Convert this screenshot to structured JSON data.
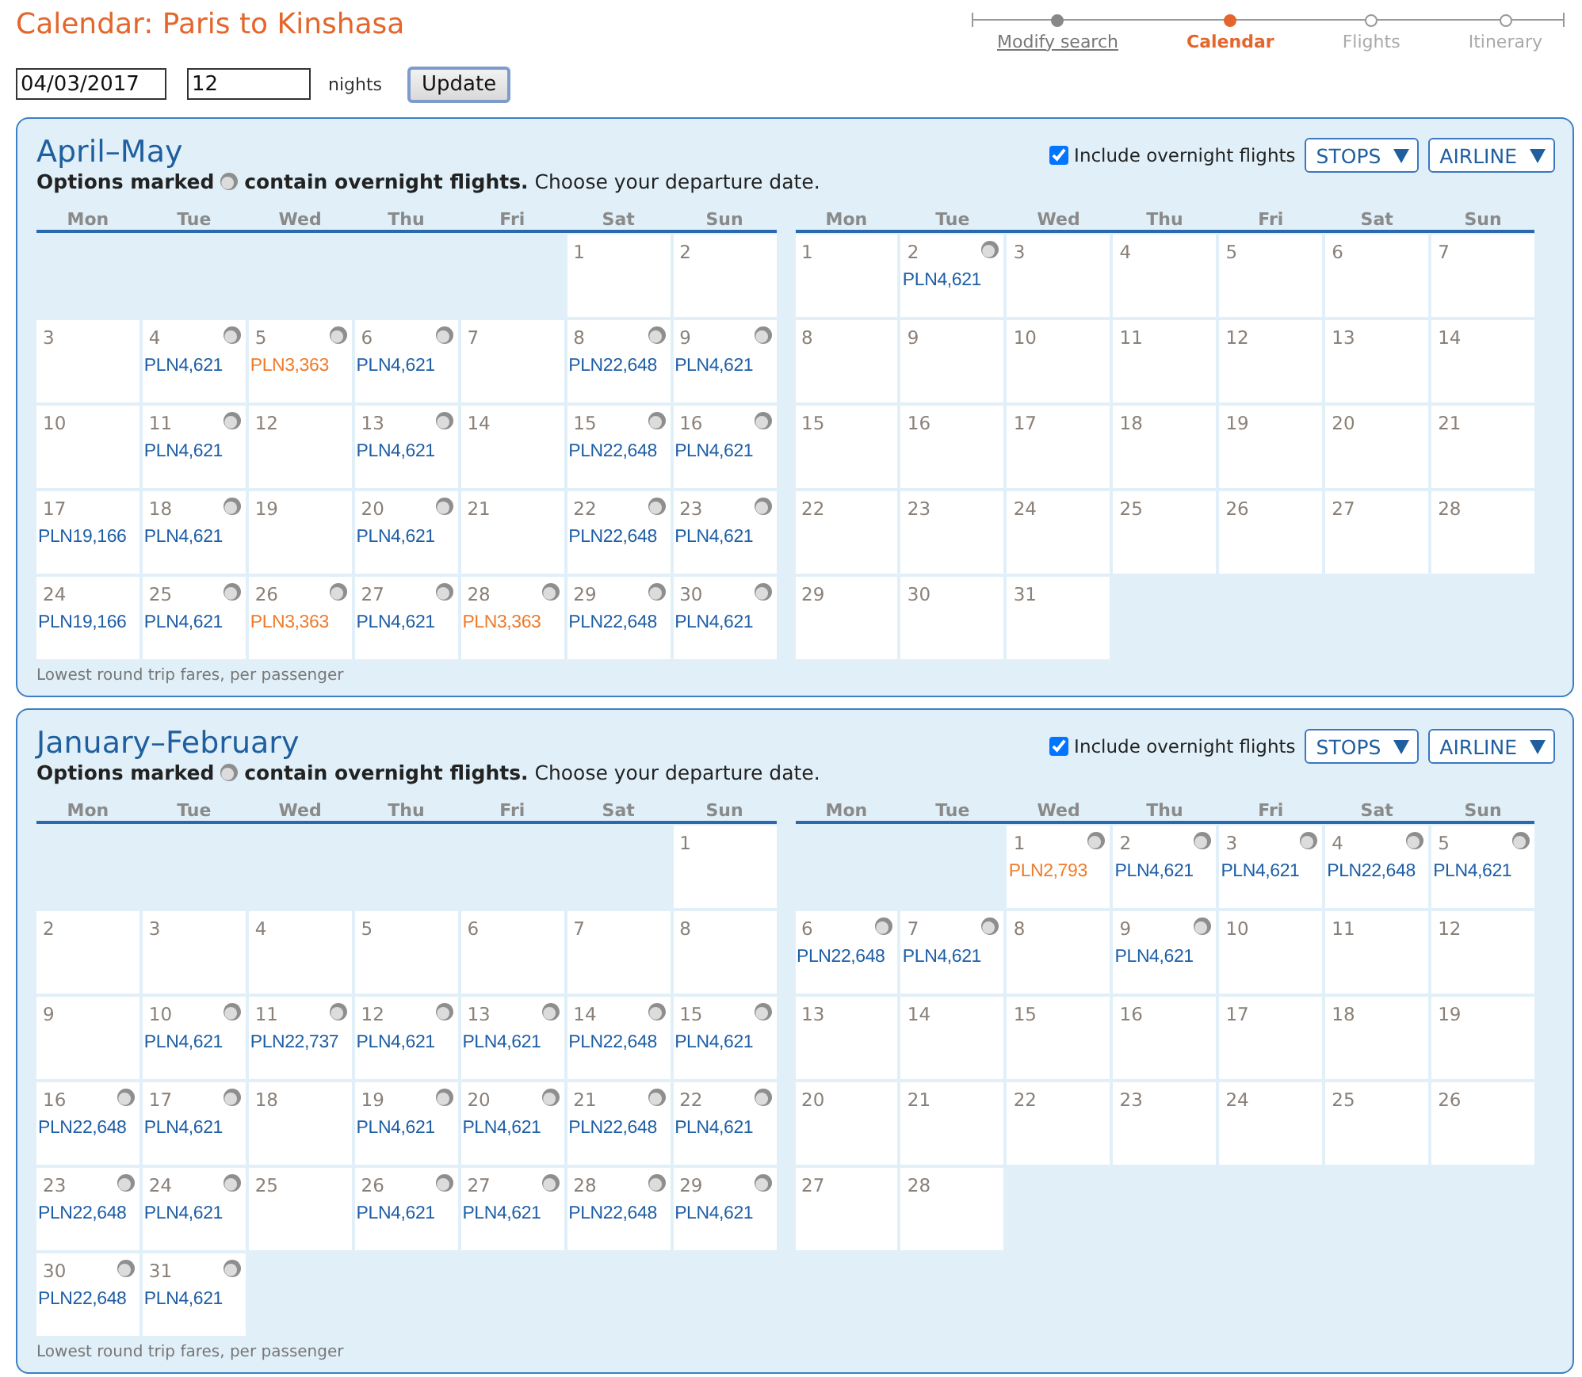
{
  "title": "Calendar: Paris to Kinshasa",
  "steps": [
    {
      "label": "Modify search",
      "completed": true,
      "selected": false
    },
    {
      "label": "Calendar",
      "completed": false,
      "selected": true
    },
    {
      "label": "Flights",
      "completed": false,
      "selected": false
    },
    {
      "label": "Itinerary",
      "completed": false,
      "selected": false
    }
  ],
  "search": {
    "date": "04/03/2017",
    "nights": "12",
    "nights_label": "nights",
    "button": "Update"
  },
  "panels": [
    {
      "title": "April–May",
      "legend": {
        "before": "Options marked",
        "after": "**contain overnight flights.** Choose your departure date."
      },
      "overnight_filter": {
        "label": "Include overnight flights",
        "checked": true
      },
      "filters": [
        {
          "label": "STOPS"
        },
        {
          "label": "AIRLINE"
        }
      ],
      "months": [
        {
          "weekdays": [
            "Mon",
            "Tue",
            "Wed",
            "Thu",
            "Fri",
            "Sat",
            "Sun"
          ],
          "days": [
            {
              "kind": "empty"
            },
            {
              "kind": "empty"
            },
            {
              "kind": "empty"
            },
            {
              "kind": "empty"
            },
            {
              "kind": "empty"
            },
            {
              "kind": "day",
              "day": "1",
              "overnight": false
            },
            {
              "kind": "day",
              "day": "2",
              "overnight": false
            },
            {
              "kind": "day",
              "day": "3",
              "overnight": false
            },
            {
              "kind": "day",
              "day": "4",
              "overnight": true,
              "fare": {
                "price": "PLN4,621",
                "lowest": false
              }
            },
            {
              "kind": "day",
              "day": "5",
              "overnight": true,
              "fare": {
                "price": "PLN3,363",
                "lowest": true
              }
            },
            {
              "kind": "day",
              "day": "6",
              "overnight": true,
              "fare": {
                "price": "PLN4,621",
                "lowest": false
              }
            },
            {
              "kind": "day",
              "day": "7",
              "overnight": false
            },
            {
              "kind": "day",
              "day": "8",
              "overnight": true,
              "fare": {
                "price": "PLN22,648",
                "lowest": false
              }
            },
            {
              "kind": "day",
              "day": "9",
              "overnight": true,
              "fare": {
                "price": "PLN4,621",
                "lowest": false
              }
            },
            {
              "kind": "day",
              "day": "10",
              "overnight": false
            },
            {
              "kind": "day",
              "day": "11",
              "overnight": true,
              "fare": {
                "price": "PLN4,621",
                "lowest": false
              }
            },
            {
              "kind": "day",
              "day": "12",
              "overnight": false
            },
            {
              "kind": "day",
              "day": "13",
              "overnight": true,
              "fare": {
                "price": "PLN4,621",
                "lowest": false
              }
            },
            {
              "kind": "day",
              "day": "14",
              "overnight": false
            },
            {
              "kind": "day",
              "day": "15",
              "overnight": true,
              "fare": {
                "price": "PLN22,648",
                "lowest": false
              }
            },
            {
              "kind": "day",
              "day": "16",
              "overnight": true,
              "fare": {
                "price": "PLN4,621",
                "lowest": false
              }
            },
            {
              "kind": "day",
              "day": "17",
              "overnight": false,
              "fare": {
                "price": "PLN19,166",
                "lowest": false
              }
            },
            {
              "kind": "day",
              "day": "18",
              "overnight": true,
              "fare": {
                "price": "PLN4,621",
                "lowest": false
              }
            },
            {
              "kind": "day",
              "day": "19",
              "overnight": false
            },
            {
              "kind": "day",
              "day": "20",
              "overnight": true,
              "fare": {
                "price": "PLN4,621",
                "lowest": false
              }
            },
            {
              "kind": "day",
              "day": "21",
              "overnight": false
            },
            {
              "kind": "day",
              "day": "22",
              "overnight": true,
              "fare": {
                "price": "PLN22,648",
                "lowest": false
              }
            },
            {
              "kind": "day",
              "day": "23",
              "overnight": true,
              "fare": {
                "price": "PLN4,621",
                "lowest": false
              }
            },
            {
              "kind": "day",
              "day": "24",
              "overnight": false,
              "fare": {
                "price": "PLN19,166",
                "lowest": false
              }
            },
            {
              "kind": "day",
              "day": "25",
              "overnight": true,
              "fare": {
                "price": "PLN4,621",
                "lowest": false
              }
            },
            {
              "kind": "day",
              "day": "26",
              "overnight": true,
              "fare": {
                "price": "PLN3,363",
                "lowest": true
              }
            },
            {
              "kind": "day",
              "day": "27",
              "overnight": true,
              "fare": {
                "price": "PLN4,621",
                "lowest": false
              }
            },
            {
              "kind": "day",
              "day": "28",
              "overnight": true,
              "fare": {
                "price": "PLN3,363",
                "lowest": true
              }
            },
            {
              "kind": "day",
              "day": "29",
              "overnight": true,
              "fare": {
                "price": "PLN22,648",
                "lowest": false
              }
            },
            {
              "kind": "day",
              "day": "30",
              "overnight": true,
              "fare": {
                "price": "PLN4,621",
                "lowest": false
              }
            }
          ]
        },
        {
          "weekdays": [
            "Mon",
            "Tue",
            "Wed",
            "Thu",
            "Fri",
            "Sat",
            "Sun"
          ],
          "days": [
            {
              "kind": "day",
              "day": "1",
              "overnight": false
            },
            {
              "kind": "day",
              "day": "2",
              "overnight": true,
              "fare": {
                "price": "PLN4,621",
                "lowest": false
              }
            },
            {
              "kind": "day",
              "day": "3",
              "overnight": false
            },
            {
              "kind": "day",
              "day": "4",
              "overnight": false
            },
            {
              "kind": "day",
              "day": "5",
              "overnight": false
            },
            {
              "kind": "day",
              "day": "6",
              "overnight": false
            },
            {
              "kind": "day",
              "day": "7",
              "overnight": false
            },
            {
              "kind": "day",
              "day": "8",
              "overnight": false
            },
            {
              "kind": "day",
              "day": "9",
              "overnight": false
            },
            {
              "kind": "day",
              "day": "10",
              "overnight": false
            },
            {
              "kind": "day",
              "day": "11",
              "overnight": false
            },
            {
              "kind": "day",
              "day": "12",
              "overnight": false
            },
            {
              "kind": "day",
              "day": "13",
              "overnight": false
            },
            {
              "kind": "day",
              "day": "14",
              "overnight": false
            },
            {
              "kind": "day",
              "day": "15",
              "overnight": false
            },
            {
              "kind": "day",
              "day": "16",
              "overnight": false
            },
            {
              "kind": "day",
              "day": "17",
              "overnight": false
            },
            {
              "kind": "day",
              "day": "18",
              "overnight": false
            },
            {
              "kind": "day",
              "day": "19",
              "overnight": false
            },
            {
              "kind": "day",
              "day": "20",
              "overnight": false
            },
            {
              "kind": "day",
              "day": "21",
              "overnight": false
            },
            {
              "kind": "day",
              "day": "22",
              "overnight": false
            },
            {
              "kind": "day",
              "day": "23",
              "overnight": false
            },
            {
              "kind": "day",
              "day": "24",
              "overnight": false
            },
            {
              "kind": "day",
              "day": "25",
              "overnight": false
            },
            {
              "kind": "day",
              "day": "26",
              "overnight": false
            },
            {
              "kind": "day",
              "day": "27",
              "overnight": false
            },
            {
              "kind": "day",
              "day": "28",
              "overnight": false
            },
            {
              "kind": "day",
              "day": "29",
              "overnight": false
            },
            {
              "kind": "day",
              "day": "30",
              "overnight": false
            },
            {
              "kind": "day",
              "day": "31",
              "overnight": false
            }
          ]
        }
      ],
      "footnote": "Lowest round trip fares, per passenger"
    },
    {
      "title": "January–February",
      "legend": {
        "before": "Options marked",
        "after": "**contain overnight flights.** Choose your departure date."
      },
      "overnight_filter": {
        "label": "Include overnight flights",
        "checked": true
      },
      "filters": [
        {
          "label": "STOPS"
        },
        {
          "label": "AIRLINE"
        }
      ],
      "months": [
        {
          "weekdays": [
            "Mon",
            "Tue",
            "Wed",
            "Thu",
            "Fri",
            "Sat",
            "Sun"
          ],
          "days": [
            {
              "kind": "empty"
            },
            {
              "kind": "empty"
            },
            {
              "kind": "empty"
            },
            {
              "kind": "empty"
            },
            {
              "kind": "empty"
            },
            {
              "kind": "empty"
            },
            {
              "kind": "day",
              "day": "1",
              "overnight": false
            },
            {
              "kind": "day",
              "day": "2",
              "overnight": false
            },
            {
              "kind": "day",
              "day": "3",
              "overnight": false
            },
            {
              "kind": "day",
              "day": "4",
              "overnight": false
            },
            {
              "kind": "day",
              "day": "5",
              "overnight": false
            },
            {
              "kind": "day",
              "day": "6",
              "overnight": false
            },
            {
              "kind": "day",
              "day": "7",
              "overnight": false
            },
            {
              "kind": "day",
              "day": "8",
              "overnight": false
            },
            {
              "kind": "day",
              "day": "9",
              "overnight": false
            },
            {
              "kind": "day",
              "day": "10",
              "overnight": true,
              "fare": {
                "price": "PLN4,621",
                "lowest": false
              }
            },
            {
              "kind": "day",
              "day": "11",
              "overnight": true,
              "fare": {
                "price": "PLN22,737",
                "lowest": false
              }
            },
            {
              "kind": "day",
              "day": "12",
              "overnight": true,
              "fare": {
                "price": "PLN4,621",
                "lowest": false
              }
            },
            {
              "kind": "day",
              "day": "13",
              "overnight": true,
              "fare": {
                "price": "PLN4,621",
                "lowest": false
              }
            },
            {
              "kind": "day",
              "day": "14",
              "overnight": true,
              "fare": {
                "price": "PLN22,648",
                "lowest": false
              }
            },
            {
              "kind": "day",
              "day": "15",
              "overnight": true,
              "fare": {
                "price": "PLN4,621",
                "lowest": false
              }
            },
            {
              "kind": "day",
              "day": "16",
              "overnight": true,
              "fare": {
                "price": "PLN22,648",
                "lowest": false
              }
            },
            {
              "kind": "day",
              "day": "17",
              "overnight": true,
              "fare": {
                "price": "PLN4,621",
                "lowest": false
              }
            },
            {
              "kind": "day",
              "day": "18",
              "overnight": false
            },
            {
              "kind": "day",
              "day": "19",
              "overnight": true,
              "fare": {
                "price": "PLN4,621",
                "lowest": false
              }
            },
            {
              "kind": "day",
              "day": "20",
              "overnight": true,
              "fare": {
                "price": "PLN4,621",
                "lowest": false
              }
            },
            {
              "kind": "day",
              "day": "21",
              "overnight": true,
              "fare": {
                "price": "PLN22,648",
                "lowest": false
              }
            },
            {
              "kind": "day",
              "day": "22",
              "overnight": true,
              "fare": {
                "price": "PLN4,621",
                "lowest": false
              }
            },
            {
              "kind": "day",
              "day": "23",
              "overnight": true,
              "fare": {
                "price": "PLN22,648",
                "lowest": false
              }
            },
            {
              "kind": "day",
              "day": "24",
              "overnight": true,
              "fare": {
                "price": "PLN4,621",
                "lowest": false
              }
            },
            {
              "kind": "day",
              "day": "25",
              "overnight": false
            },
            {
              "kind": "day",
              "day": "26",
              "overnight": true,
              "fare": {
                "price": "PLN4,621",
                "lowest": false
              }
            },
            {
              "kind": "day",
              "day": "27",
              "overnight": true,
              "fare": {
                "price": "PLN4,621",
                "lowest": false
              }
            },
            {
              "kind": "day",
              "day": "28",
              "overnight": true,
              "fare": {
                "price": "PLN22,648",
                "lowest": false
              }
            },
            {
              "kind": "day",
              "day": "29",
              "overnight": true,
              "fare": {
                "price": "PLN4,621",
                "lowest": false
              }
            },
            {
              "kind": "day",
              "day": "30",
              "overnight": true,
              "fare": {
                "price": "PLN22,648",
                "lowest": false
              }
            },
            {
              "kind": "day",
              "day": "31",
              "overnight": true,
              "fare": {
                "price": "PLN4,621",
                "lowest": false
              }
            }
          ]
        },
        {
          "weekdays": [
            "Mon",
            "Tue",
            "Wed",
            "Thu",
            "Fri",
            "Sat",
            "Sun"
          ],
          "days": [
            {
              "kind": "empty"
            },
            {
              "kind": "empty"
            },
            {
              "kind": "day",
              "day": "1",
              "overnight": true,
              "fare": {
                "price": "PLN2,793",
                "lowest": true
              }
            },
            {
              "kind": "day",
              "day": "2",
              "overnight": true,
              "fare": {
                "price": "PLN4,621",
                "lowest": false
              }
            },
            {
              "kind": "day",
              "day": "3",
              "overnight": true,
              "fare": {
                "price": "PLN4,621",
                "lowest": false
              }
            },
            {
              "kind": "day",
              "day": "4",
              "overnight": true,
              "fare": {
                "price": "PLN22,648",
                "lowest": false
              }
            },
            {
              "kind": "day",
              "day": "5",
              "overnight": true,
              "fare": {
                "price": "PLN4,621",
                "lowest": false
              }
            },
            {
              "kind": "day",
              "day": "6",
              "overnight": true,
              "fare": {
                "price": "PLN22,648",
                "lowest": false
              }
            },
            {
              "kind": "day",
              "day": "7",
              "overnight": true,
              "fare": {
                "price": "PLN4,621",
                "lowest": false
              }
            },
            {
              "kind": "day",
              "day": "8",
              "overnight": false
            },
            {
              "kind": "day",
              "day": "9",
              "overnight": true,
              "fare": {
                "price": "PLN4,621",
                "lowest": false
              }
            },
            {
              "kind": "day",
              "day": "10",
              "overnight": false
            },
            {
              "kind": "day",
              "day": "11",
              "overnight": false
            },
            {
              "kind": "day",
              "day": "12",
              "overnight": false
            },
            {
              "kind": "day",
              "day": "13",
              "overnight": false
            },
            {
              "kind": "day",
              "day": "14",
              "overnight": false
            },
            {
              "kind": "day",
              "day": "15",
              "overnight": false
            },
            {
              "kind": "day",
              "day": "16",
              "overnight": false
            },
            {
              "kind": "day",
              "day": "17",
              "overnight": false
            },
            {
              "kind": "day",
              "day": "18",
              "overnight": false
            },
            {
              "kind": "day",
              "day": "19",
              "overnight": false
            },
            {
              "kind": "day",
              "day": "20",
              "overnight": false
            },
            {
              "kind": "day",
              "day": "21",
              "overnight": false
            },
            {
              "kind": "day",
              "day": "22",
              "overnight": false
            },
            {
              "kind": "day",
              "day": "23",
              "overnight": false
            },
            {
              "kind": "day",
              "day": "24",
              "overnight": false
            },
            {
              "kind": "day",
              "day": "25",
              "overnight": false
            },
            {
              "kind": "day",
              "day": "26",
              "overnight": false
            },
            {
              "kind": "day",
              "day": "27",
              "overnight": false
            },
            {
              "kind": "day",
              "day": "28",
              "overnight": false
            }
          ]
        }
      ],
      "footnote": "Lowest round trip fares, per passenger"
    }
  ]
}
